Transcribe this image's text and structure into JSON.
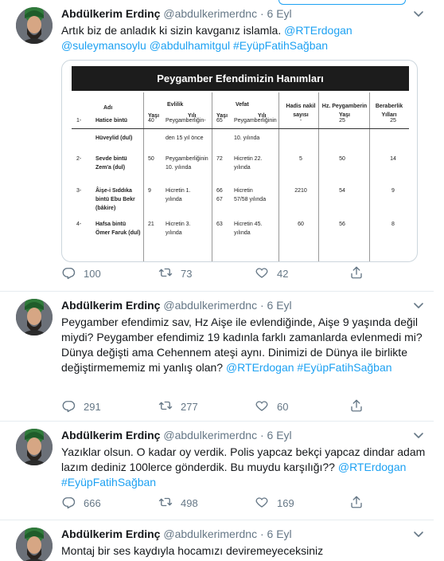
{
  "tweets": [
    {
      "name": "Abdülkerim Erdinç",
      "handle": "@abdulkerimerdnc",
      "sep": "·",
      "date": "6 Eyl",
      "text_parts": [
        {
          "t": "Artık biz de anladık ki sizin kavganız islamla. ",
          "link": false
        },
        {
          "t": "@RTErdogan",
          "link": true
        },
        {
          "t": " ",
          "link": false
        },
        {
          "t": "@suleymansoylu",
          "link": true
        },
        {
          "t": " ",
          "link": false
        },
        {
          "t": "@abdulhamitgul",
          "link": true
        },
        {
          "t": " ",
          "link": false
        },
        {
          "t": "#EyüpFatihSağban",
          "link": true
        }
      ],
      "replies": "100",
      "retweets": "73",
      "likes": "42"
    },
    {
      "name": "Abdülkerim Erdinç",
      "handle": "@abdulkerimerdnc",
      "sep": "·",
      "date": "6 Eyl",
      "text_parts": [
        {
          "t": "Peygamber efendimiz sav, Hz Aişe ile evlendiğinde, Aişe 9 yaşında değil miydi? Peygamber efendimiz 19 kadınla farklı zamanlarda evlenmedi mi? Dünya değişti ama Cehennem ateşi aynı. Dinimizi de Dünya ile birlikte değiştirmememiz mi yanlış olan? ",
          "link": false
        },
        {
          "t": "@RTErdogan",
          "link": true
        },
        {
          "t": " ",
          "link": false
        },
        {
          "t": "#EyüpFatihSağban",
          "link": true
        }
      ],
      "replies": "291",
      "retweets": "277",
      "likes": "60"
    },
    {
      "name": "Abdülkerim Erdinç",
      "handle": "@abdulkerimerdnc",
      "sep": "·",
      "date": "6 Eyl",
      "text_parts": [
        {
          "t": "Yazıklar olsun. O kadar oy verdik. Polis yapcaz bekçi yapcaz dindar adam lazım dediniz 100lerce gönderdik. Bu muydu karşılığı?? ",
          "link": false
        },
        {
          "t": "@RTErdogan",
          "link": true
        },
        {
          "t": " ",
          "link": false
        },
        {
          "t": "#EyüpFatihSağban",
          "link": true
        }
      ],
      "replies": "666",
      "retweets": "498",
      "likes": "169"
    },
    {
      "name": "Abdülkerim Erdinç",
      "handle": "@abdulkerimerdnc",
      "sep": "·",
      "date": "6 Eyl",
      "text_parts": [
        {
          "t": "Montaj bir ses kaydıyla hocamızı deviremeyeceksiniz",
          "link": false
        }
      ]
    }
  ],
  "media_table": {
    "title": "Peygamber Efendimizin Hanımları",
    "headers": {
      "adi": "Adı",
      "evlilik": "Evlilik",
      "vefat": "Vefat",
      "yasi": "Yaşı",
      "yili": "Yılı",
      "hadis": "Hadis nakil\nsayısı",
      "hz_yasi": "Hz. Peygamberin\nYaşı",
      "beraberlik": "Beraberlik\nYılları"
    },
    "rows": [
      {
        "no": "1-",
        "adi": "Hatice bintü\n\nHüveylid (dul)",
        "ev_yas": "40",
        "ev_yil": "Peygamberliğin-\n\nden 15 yıl önce",
        "ve_yas": "65",
        "ve_yil": "Peygamberliğinin\n\n10. yılında",
        "hadis": "-",
        "hz": "25",
        "ber": "25"
      },
      {
        "no": "2-",
        "adi": "Sevde bintü\nZem'a (dul)",
        "ev_yas": "50",
        "ev_yil": "Peygamberliğinin\n10. yılında",
        "ve_yas": "72",
        "ve_yil": "Hicretin 22.\nyılında",
        "hadis": "5",
        "hz": "50",
        "ber": "14"
      },
      {
        "no": "3-",
        "adi": "Âişe-i Sıddıka\nbintü Ebu Bekr\n(bâkire)",
        "ev_yas": "9",
        "ev_yil": "Hicretin 1.\nyılında",
        "ve_yas": "66\n67",
        "ve_yil": "Hicretin\n57/58 yılında",
        "hadis": "2210",
        "hz": "54",
        "ber": "9"
      },
      {
        "no": "4-",
        "adi": "Hafsa bintü\nÖmer Faruk (dul)",
        "ev_yas": "21",
        "ev_yil": "Hicretin 3.\nyılında",
        "ve_yas": "63",
        "ve_yil": "Hicretin 45.\nyılında",
        "hadis": "60",
        "hz": "56",
        "ber": "8"
      }
    ]
  },
  "icons": {
    "reply": "reply-icon",
    "retweet": "retweet-icon",
    "like": "heart-icon",
    "share": "share-icon",
    "caret": "chevron-down-icon"
  },
  "colors": {
    "link": "#1da1f2",
    "muted": "#657786",
    "text": "#14171a"
  }
}
